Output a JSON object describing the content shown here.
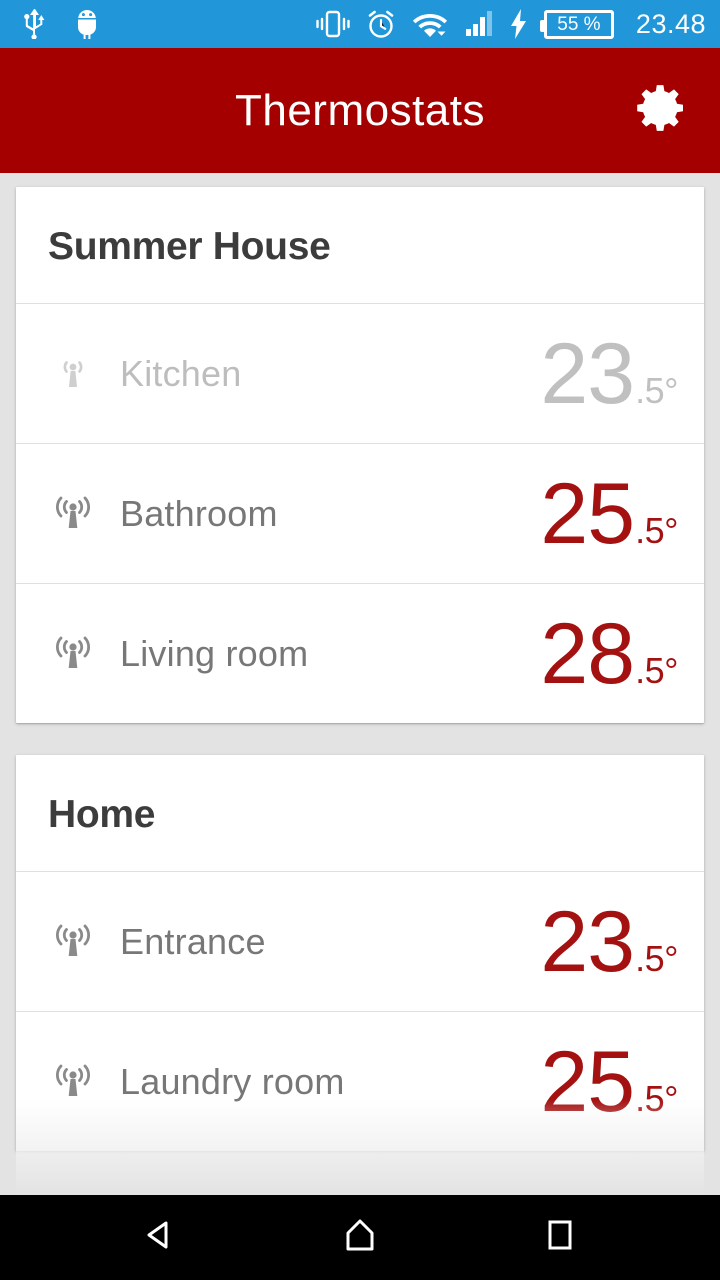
{
  "statusbar": {
    "left_icons": [
      {
        "name": "usb-icon"
      },
      {
        "name": "android-debug-icon"
      }
    ],
    "right_icons": [
      {
        "name": "vibrate-icon"
      },
      {
        "name": "alarm-icon"
      },
      {
        "name": "wifi-icon"
      },
      {
        "name": "cellular-signal-icon"
      },
      {
        "name": "charging-bolt-icon"
      }
    ],
    "battery_level": "55 %",
    "time": "23.48"
  },
  "appbar": {
    "title": "Thermostats",
    "action_icon": "gear-icon",
    "background": "#a40000"
  },
  "colors": {
    "accent_red": "#a40000",
    "temp_red": "#a41111",
    "inactive_gray": "#c0c0c0",
    "page_background": "#e3e3e3",
    "status_blue": "#2196d9"
  },
  "groups": [
    {
      "title": "Summer House",
      "rows": [
        {
          "label": "Kitchen",
          "temp_int": "23",
          "temp_frac": ".5°",
          "signal": "weak",
          "active": false
        },
        {
          "label": "Bathroom",
          "temp_int": "25",
          "temp_frac": ".5°",
          "signal": "strong",
          "active": true
        },
        {
          "label": "Living room",
          "temp_int": "28",
          "temp_frac": ".5°",
          "signal": "strong",
          "active": true
        }
      ]
    },
    {
      "title": "Home",
      "rows": [
        {
          "label": "Entrance",
          "temp_int": "23",
          "temp_frac": ".5°",
          "signal": "strong",
          "active": true
        },
        {
          "label": "Laundry room",
          "temp_int": "25",
          "temp_frac": ".5°",
          "signal": "strong",
          "active": true
        }
      ]
    }
  ],
  "navbar": {
    "buttons": [
      {
        "name": "back-button"
      },
      {
        "name": "home-button"
      },
      {
        "name": "recents-button"
      }
    ]
  }
}
